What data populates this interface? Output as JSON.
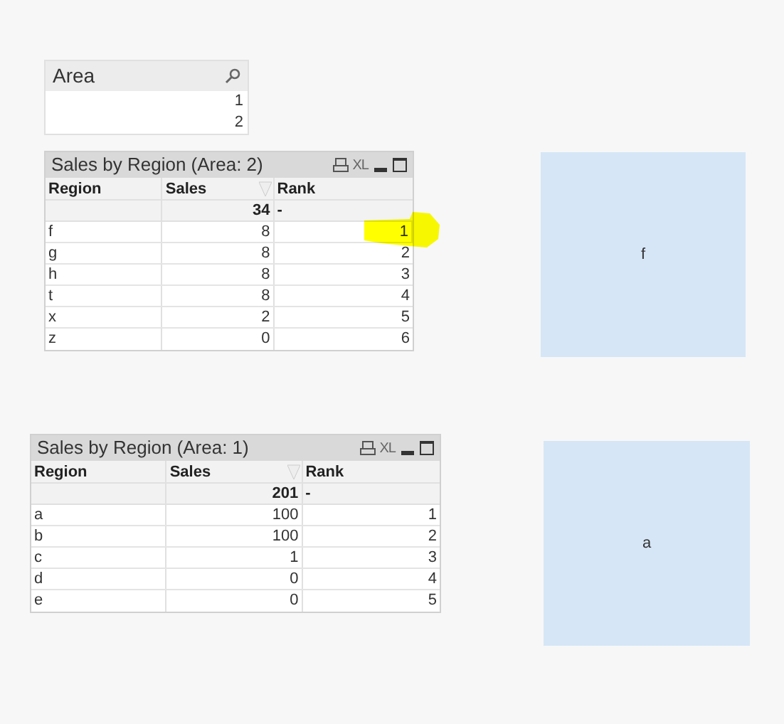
{
  "listbox": {
    "title": "Area",
    "values": [
      "1",
      "2"
    ]
  },
  "tables": [
    {
      "title": "Sales by Region (Area: 2)",
      "export_label": "XL",
      "columns": [
        {
          "label": "Region",
          "sorted": false
        },
        {
          "label": "Sales",
          "sorted": true
        },
        {
          "label": "Rank",
          "sorted": false
        }
      ],
      "totals": {
        "sales": "34",
        "rank": "-"
      },
      "rows": [
        {
          "cells": [
            "f",
            "8",
            "1"
          ],
          "highlighted": true
        },
        {
          "cells": [
            "g",
            "8",
            "2"
          ],
          "highlighted": false
        },
        {
          "cells": [
            "h",
            "8",
            "3"
          ],
          "highlighted": false
        },
        {
          "cells": [
            "t",
            "8",
            "4"
          ],
          "highlighted": false
        },
        {
          "cells": [
            "x",
            "2",
            "5"
          ],
          "highlighted": false
        },
        {
          "cells": [
            "z",
            "0",
            "6"
          ],
          "highlighted": false
        }
      ],
      "text_box": {
        "text": "f"
      }
    },
    {
      "title": "Sales by Region (Area: 1)",
      "export_label": "XL",
      "columns": [
        {
          "label": "Region",
          "sorted": false
        },
        {
          "label": "Sales",
          "sorted": true
        },
        {
          "label": "Rank",
          "sorted": false
        }
      ],
      "totals": {
        "sales": "201",
        "rank": "-"
      },
      "rows": [
        {
          "cells": [
            "a",
            "100",
            "1"
          ],
          "highlighted": false
        },
        {
          "cells": [
            "b",
            "100",
            "2"
          ],
          "highlighted": false
        },
        {
          "cells": [
            "c",
            "1",
            "3"
          ],
          "highlighted": false
        },
        {
          "cells": [
            "d",
            "0",
            "4"
          ],
          "highlighted": false
        },
        {
          "cells": [
            "e",
            "0",
            "5"
          ],
          "highlighted": false
        }
      ],
      "text_box": {
        "text": "a"
      }
    }
  ]
}
